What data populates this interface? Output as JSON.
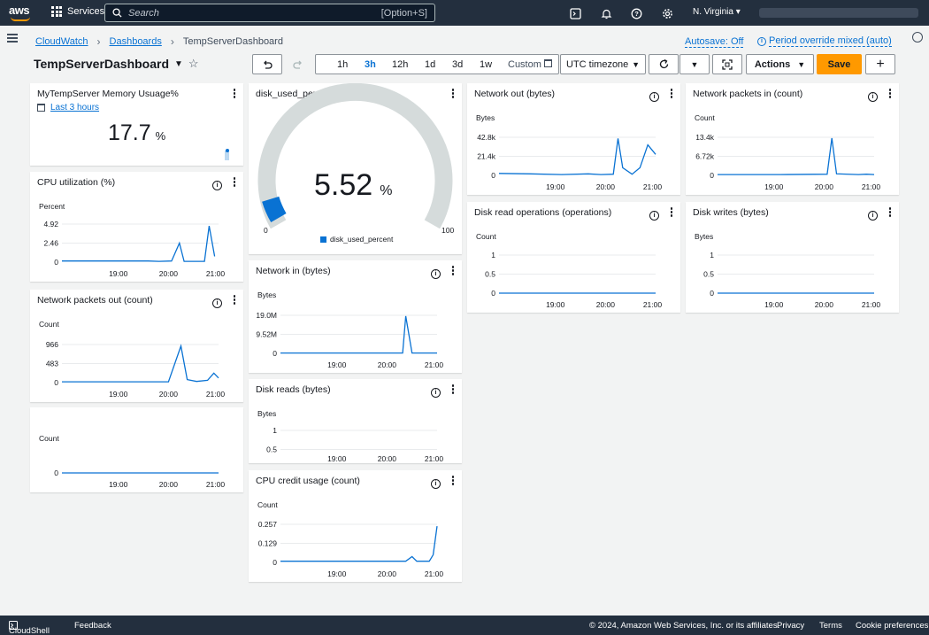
{
  "nav": {
    "services": "Services",
    "search_placeholder": "Search",
    "search_shortcut": "[Option+S]",
    "region": "N. Virginia"
  },
  "breadcrumb": {
    "cloudwatch": "CloudWatch",
    "dashboards": "Dashboards",
    "current": "TempServerDashboard"
  },
  "header": {
    "autosave": "Autosave: Off",
    "period_override": "Period override mixed (auto)",
    "title": "TempServerDashboard"
  },
  "toolbar": {
    "ranges": [
      "1h",
      "3h",
      "12h",
      "1d",
      "3d",
      "1w"
    ],
    "selected_range": "3h",
    "custom": "Custom",
    "timezone": "UTC timezone",
    "actions": "Actions",
    "save": "Save"
  },
  "colors": {
    "line": "#0972d3",
    "accent": "#ff9900",
    "nav_bg": "#232f3e",
    "gauge_track": "#d5dbdb"
  },
  "widgets": {
    "memory": {
      "title": "MyTempServer Memory Usuage%",
      "period": "Last 3 hours",
      "value": "17.7",
      "unit": "%"
    },
    "disk_used": {
      "title": "disk_used_percent",
      "value": "5.52",
      "unit": "%",
      "min": "0",
      "max": "100",
      "legend": "disk_used_percent"
    },
    "cpu": {
      "title": "CPU utilization (%)",
      "unit": "Percent",
      "yticks": [
        "4.92",
        "2.46",
        "0"
      ],
      "xticks": [
        "19:00",
        "20:00",
        "21:00"
      ]
    },
    "net_pkt_out": {
      "title": "Network packets out (count)",
      "unit": "Count",
      "yticks": [
        "966",
        "483",
        "0"
      ],
      "xticks": [
        "19:00",
        "20:00",
        "21:00"
      ]
    },
    "blank": {
      "unit": "Count",
      "yticks": [
        "0"
      ],
      "xticks": [
        "19:00",
        "20:00",
        "21:00"
      ]
    },
    "net_in": {
      "title": "Network in (bytes)",
      "unit": "Bytes",
      "yticks": [
        "19.0M",
        "9.52M",
        "0"
      ],
      "xticks": [
        "19:00",
        "20:00",
        "21:00"
      ]
    },
    "disk_reads": {
      "title": "Disk reads (bytes)",
      "unit": "Bytes",
      "yticks": [
        "1",
        "0.5"
      ],
      "xticks": [
        "19:00",
        "20:00",
        "21:00"
      ]
    },
    "cpu_credit": {
      "title": "CPU credit usage (count)",
      "unit": "Count",
      "yticks": [
        "0.257",
        "0.129",
        "0"
      ],
      "xticks": [
        "19:00",
        "20:00",
        "21:00"
      ]
    },
    "net_out": {
      "title": "Network out (bytes)",
      "unit": "Bytes",
      "yticks": [
        "42.8k",
        "21.4k",
        "0"
      ],
      "xticks": [
        "19:00",
        "20:00",
        "21:00"
      ]
    },
    "disk_read_ops": {
      "title": "Disk read operations (operations)",
      "unit": "Count",
      "yticks": [
        "1",
        "0.5",
        "0"
      ],
      "xticks": [
        "19:00",
        "20:00",
        "21:00"
      ]
    },
    "net_pkt_in": {
      "title": "Network packets in (count)",
      "unit": "Count",
      "yticks": [
        "13.4k",
        "6.72k",
        "0"
      ],
      "xticks": [
        "19:00",
        "20:00",
        "21:00"
      ]
    },
    "disk_writes": {
      "title": "Disk writes (bytes)",
      "unit": "Bytes",
      "yticks": [
        "1",
        "0.5",
        "0"
      ],
      "xticks": [
        "19:00",
        "20:00",
        "21:00"
      ]
    }
  },
  "footer": {
    "cloudshell": "CloudShell",
    "feedback": "Feedback",
    "copyright": "© 2024, Amazon Web Services, Inc. or its affiliates.",
    "privacy": "Privacy",
    "terms": "Terms",
    "cookies": "Cookie preferences"
  }
}
